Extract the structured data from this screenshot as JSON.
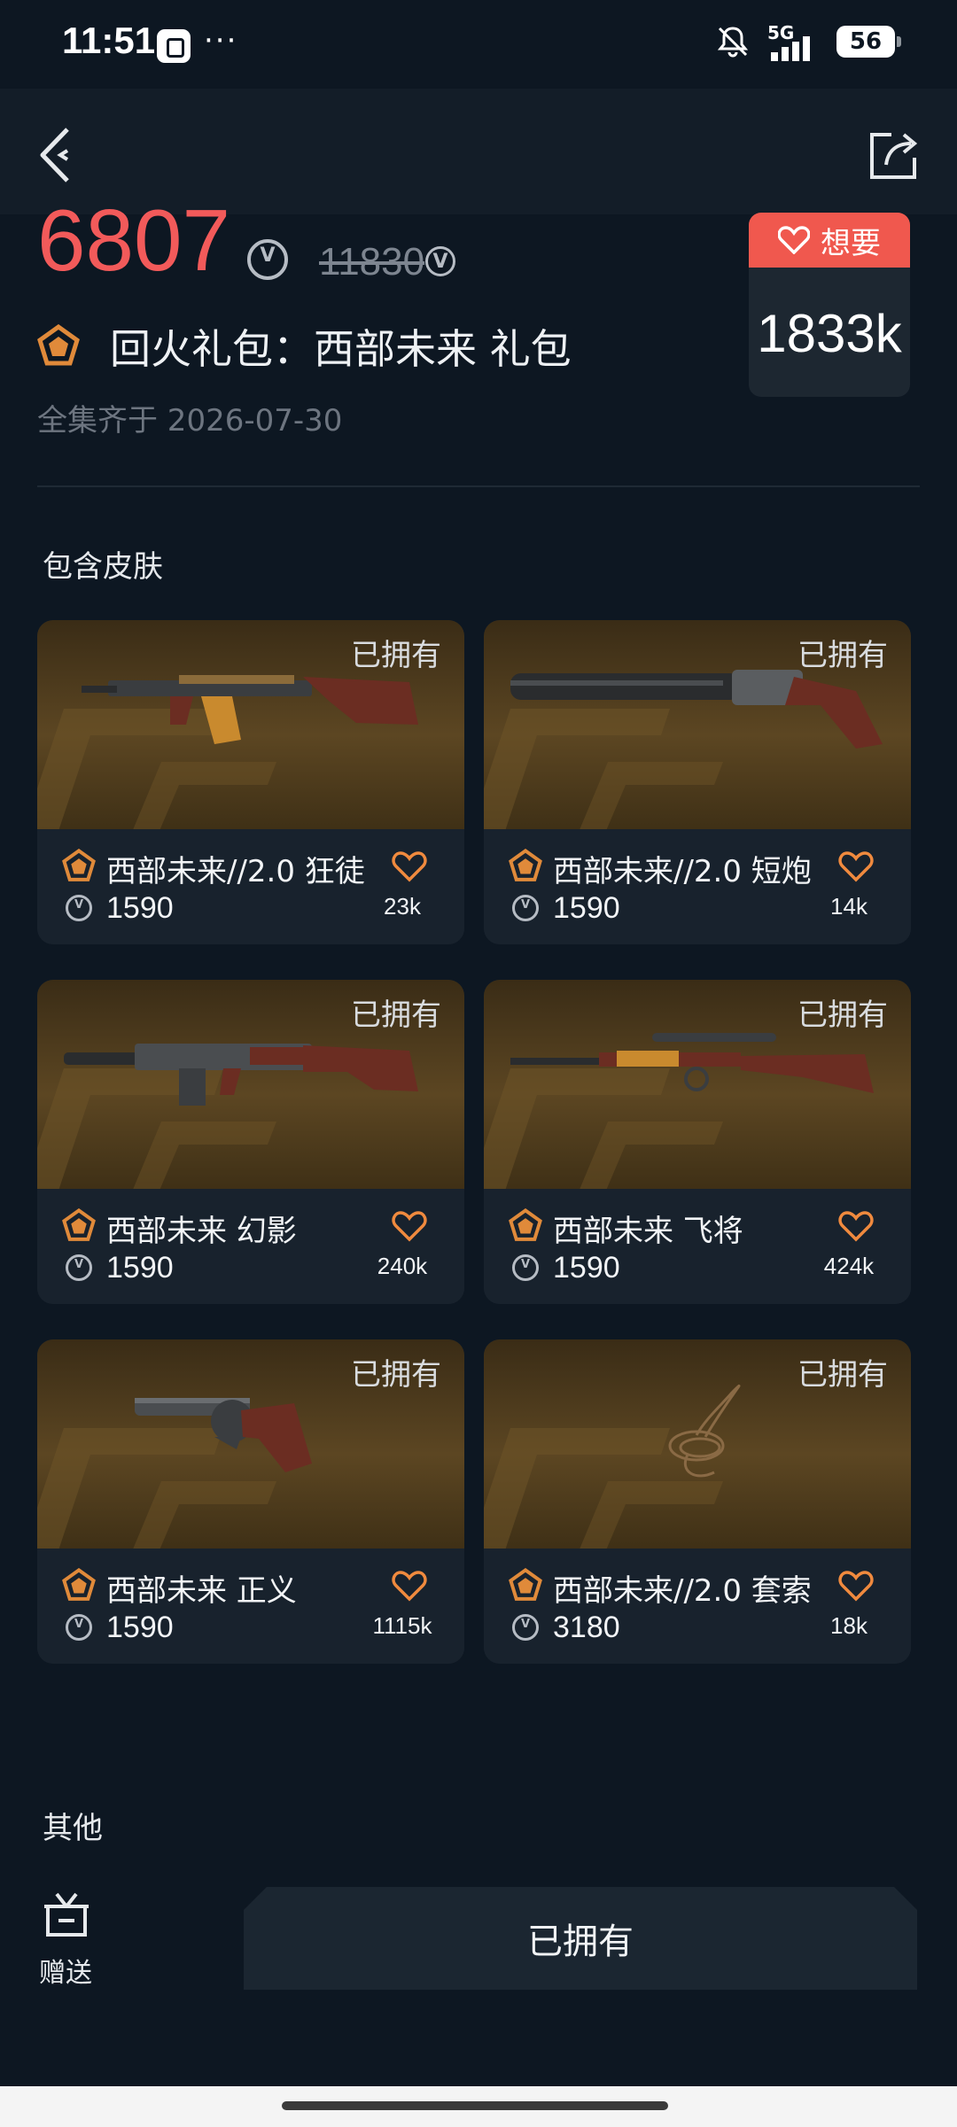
{
  "status_bar": {
    "time": "11:51",
    "dots": "···",
    "network": "5G",
    "battery": "56"
  },
  "header": {
    "back_icon": "back-arrow-icon",
    "share_icon": "share-icon"
  },
  "bundle": {
    "price": "6807",
    "original_price": "11830",
    "title": "回火礼包：西部未来 礼包",
    "date_text": "全集齐于 2026-07-30",
    "want_label": "想要",
    "want_count": "1833k"
  },
  "skins_section": {
    "title": "包含皮肤",
    "owned_label": "已拥有",
    "items": [
      {
        "name": "西部未来//2.0 狂徒",
        "price": "1590",
        "likes": "23k",
        "weapon": "rifle-ak"
      },
      {
        "name": "西部未来//2.0 短炮",
        "price": "1590",
        "likes": "14k",
        "weapon": "shotgun-short"
      },
      {
        "name": "西部未来 幻影",
        "price": "1590",
        "likes": "240k",
        "weapon": "rifle-phantom"
      },
      {
        "name": "西部未来 飞将",
        "price": "1590",
        "likes": "424k",
        "weapon": "sniper-lever"
      },
      {
        "name": "西部未来 正义",
        "price": "1590",
        "likes": "1115k",
        "weapon": "revolver"
      },
      {
        "name": "西部未来//2.0 套索",
        "price": "3180",
        "likes": "18k",
        "weapon": "lasso"
      }
    ]
  },
  "other_section": {
    "title": "其他",
    "gift_label": "赠送",
    "owned_button": "已拥有"
  },
  "colors": {
    "background": "#0d1722",
    "price_red": "#f25a5a",
    "want_red": "#f0584e",
    "heart_orange": "#f08a3e",
    "tier_orange": "#e08a3a"
  }
}
